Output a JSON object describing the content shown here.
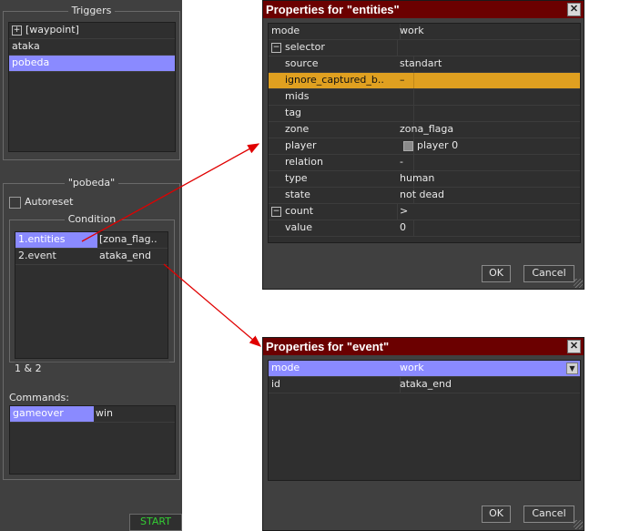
{
  "left_panel": {
    "triggers_title": "Triggers",
    "trigger_items": [
      "[waypoint]",
      "ataka",
      "pobeda"
    ],
    "selected_trigger_title": "\"pobeda\"",
    "autoreset_label": "Autoreset",
    "condition_title": "Condition",
    "conditions": [
      {
        "name": "1.entities",
        "value": "[zona_flag.."
      },
      {
        "name": "2.event",
        "value": "ataka_end"
      }
    ],
    "condition_expression": "1 & 2",
    "commands_label": "Commands:",
    "commands": [
      {
        "name": "gameover",
        "value": "win"
      }
    ],
    "start_label": "START"
  },
  "entities_dialog": {
    "title": "Properties for \"entities\"",
    "close_glyph": "✕",
    "toggle_minus": "−",
    "rows": [
      {
        "name": "mode",
        "value": "work"
      },
      {
        "name": "selector",
        "value": ""
      },
      {
        "name": "source",
        "value": "standart"
      },
      {
        "name": "ignore_captured_b..",
        "value": "–"
      },
      {
        "name": "mids",
        "value": ""
      },
      {
        "name": "tag",
        "value": ""
      },
      {
        "name": "zone",
        "value": "zona_flaga"
      },
      {
        "name": "player",
        "value": "player 0"
      },
      {
        "name": "relation",
        "value": "-"
      },
      {
        "name": "type",
        "value": "human"
      },
      {
        "name": "state",
        "value": "not dead"
      },
      {
        "name": "count",
        "value": ">"
      },
      {
        "name": "value",
        "value": "0"
      }
    ],
    "ok_label": "OK",
    "cancel_label": "Cancel"
  },
  "event_dialog": {
    "title": "Properties for \"event\"",
    "close_glyph": "✕",
    "dropdown_glyph": "▼",
    "rows": [
      {
        "name": "mode",
        "value": "work"
      },
      {
        "name": "id",
        "value": "ataka_end"
      }
    ],
    "ok_label": "OK",
    "cancel_label": "Cancel"
  },
  "colors": {
    "panel_bg": "#404040",
    "list_bg": "#2f2f2f",
    "selection": "#8a8aff",
    "highlight_row": "#e0a020",
    "titlebar": "#6b0000",
    "arrow": "#e00000",
    "start_text": "#33cc33"
  },
  "icons": [
    "plus-expander-icon",
    "minus-collapse-icon",
    "close-icon",
    "dropdown-arrow-icon",
    "checkbox-icon",
    "resize-grip-icon",
    "arrow-icon"
  ]
}
